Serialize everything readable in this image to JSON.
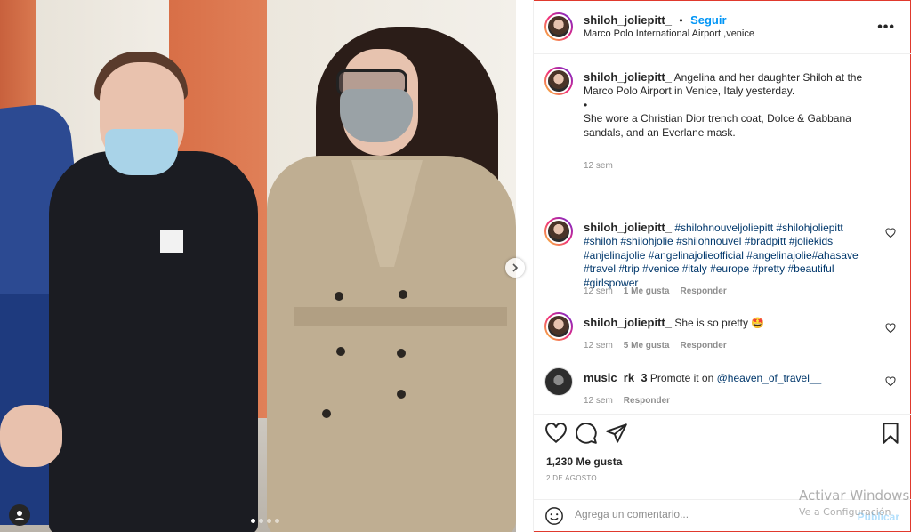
{
  "post": {
    "username": "shiloh_joliepitt_",
    "separator": "•",
    "follow_label": "Seguir",
    "location": "Marco Polo International Airport ,venice",
    "more_icon": "more-horizontal-icon"
  },
  "caption": {
    "username": "shiloh_joliepitt_",
    "line1": "Angelina and her daughter Shiloh at the Marco Polo Airport in Venice, Italy yesterday.",
    "bullet": "•",
    "line2": "She wore a Christian Dior trench coat, Dolce & Gabbana sandals, and an Everlane mask.",
    "time": "12 sem"
  },
  "comments": [
    {
      "username": "shiloh_joliepitt_",
      "text": "#shilohnouveljoliepitt #shilohjoliepitt #shiloh #shilohjolie #shilohnouvel #bradpitt #joliekids #anjelinajolie #angelinajolieofficial #angelinajolie#ahasave #travel #trip #venice #italy #europe #pretty #beautiful #girlspower",
      "time": "12 sem",
      "likes": "1 Me gusta",
      "reply": "Responder"
    },
    {
      "username": "shiloh_joliepitt_",
      "text": "She is so pretty 🤩",
      "time": "12 sem",
      "likes": "5 Me gusta",
      "reply": "Responder"
    },
    {
      "username": "music_rk_3",
      "text": "Promote it on ",
      "mention": "@heaven_of_travel__",
      "time": "12 sem",
      "reply": "Responder"
    }
  ],
  "actions": {
    "likes": "1,230 Me gusta",
    "date": "2 DE AGOSTO",
    "icons": [
      "heart-icon",
      "comment-icon",
      "share-icon",
      "bookmark-icon"
    ]
  },
  "add_comment": {
    "placeholder": "Agrega un comentario...",
    "publish": "Publicar"
  },
  "carousel": {
    "dots": 4,
    "active_index": 0
  },
  "watermark": {
    "line1": "Activar Windows",
    "line2": "Ve a Configuración"
  },
  "colors": {
    "accent": "#0095f6",
    "mention": "#00376b",
    "muted": "#8e8e8e",
    "border": "#efefef",
    "frame": "#e0392d"
  }
}
